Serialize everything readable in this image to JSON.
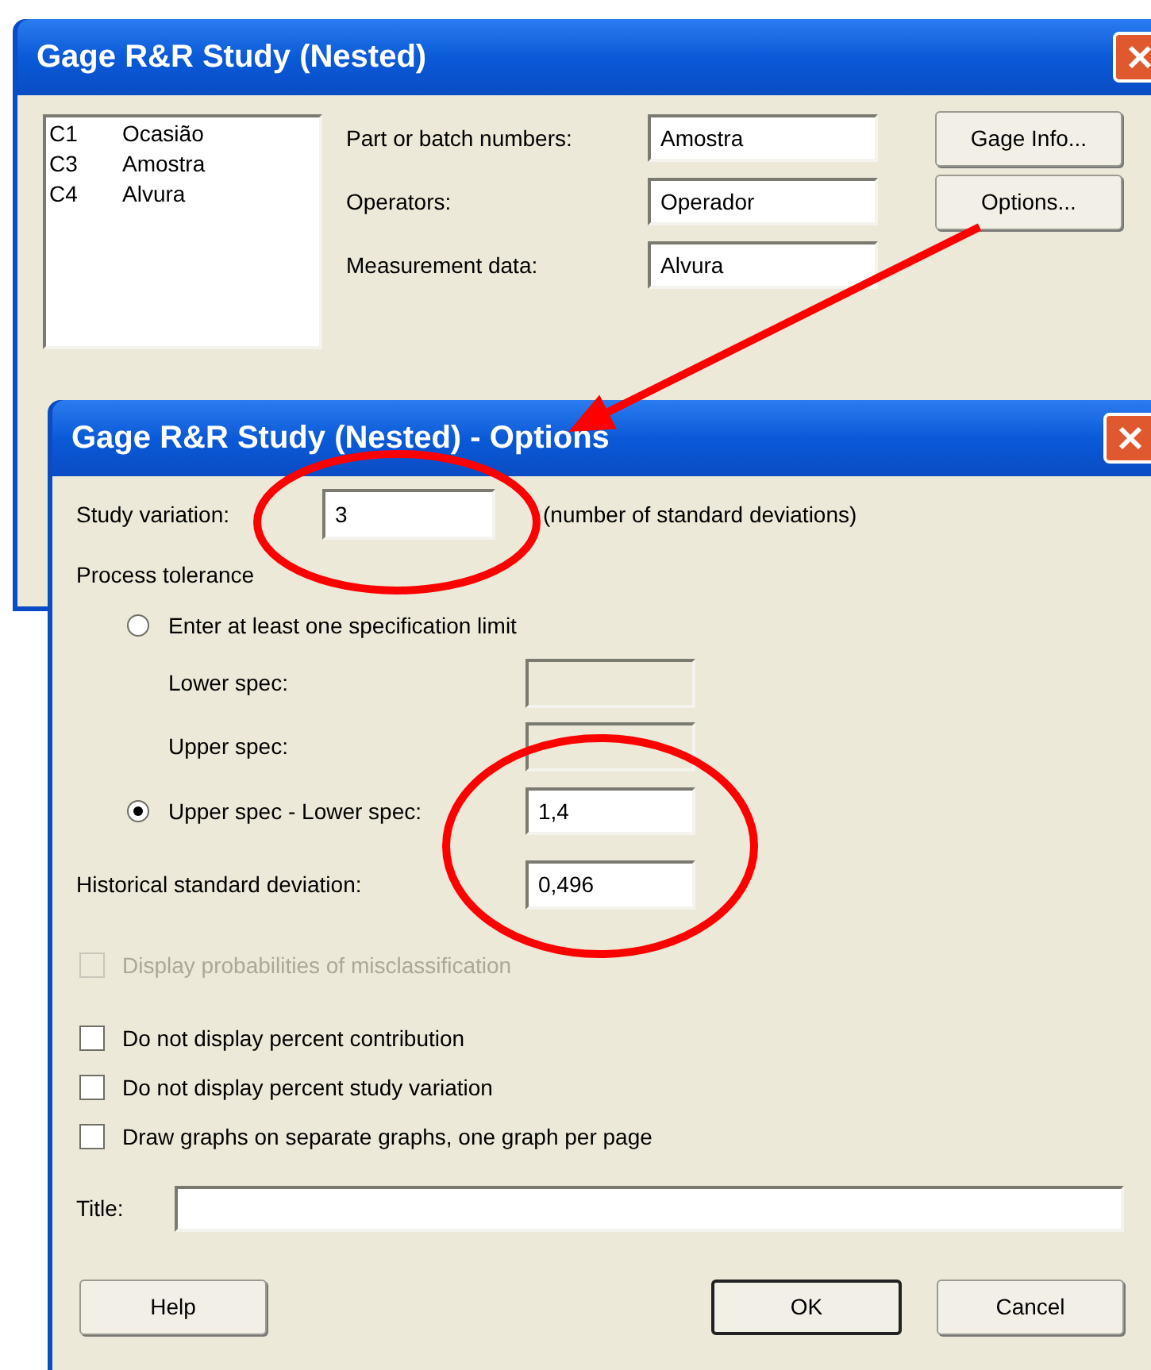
{
  "main_dialog": {
    "title": "Gage R&R Study (Nested)",
    "columns": [
      {
        "id": "C1",
        "name": "Ocasião"
      },
      {
        "id": "C3",
        "name": "Amostra"
      },
      {
        "id": "C4",
        "name": "Alvura"
      }
    ],
    "fields": [
      {
        "label": "Part or batch numbers:",
        "value": "Amostra"
      },
      {
        "label": "Operators:",
        "value": "Operador"
      },
      {
        "label": "Measurement data:",
        "value": "Alvura"
      }
    ],
    "buttons": [
      "Gage Info...",
      "Options..."
    ]
  },
  "options_dialog": {
    "title": "Gage R&R Study (Nested) - Options",
    "study_variation": {
      "label": "Study variation:",
      "value": "3",
      "note": "(number of standard deviations)"
    },
    "process_tolerance": "Process tolerance",
    "tolerance_rows": [
      {
        "kind": "radio",
        "label": "Enter at least one specification limit",
        "selected": false
      },
      {
        "kind": "field",
        "label": "Lower spec:",
        "disabled": true
      },
      {
        "kind": "field",
        "label": "Upper spec:",
        "disabled": true
      },
      {
        "kind": "radio",
        "label": "Upper spec - Lower spec:",
        "selected": true,
        "value": "1,4"
      }
    ],
    "historical": {
      "label": "Historical standard deviation:",
      "value": "0,496"
    },
    "checkboxes": [
      {
        "label": "Display probabilities of misclassification",
        "checked": false,
        "disabled": true
      },
      {
        "label": "Do not display percent contribution",
        "checked": false,
        "disabled": false
      },
      {
        "label": "Do not display percent study variation",
        "checked": false,
        "disabled": false
      },
      {
        "label": "Draw graphs on separate graphs, one graph per page",
        "checked": false,
        "disabled": false
      }
    ],
    "title_field": {
      "label": "Title:"
    },
    "buttons": [
      {
        "label": "Help",
        "default": false
      },
      {
        "label": "OK",
        "default": true
      },
      {
        "label": "Cancel",
        "default": false
      }
    ]
  }
}
